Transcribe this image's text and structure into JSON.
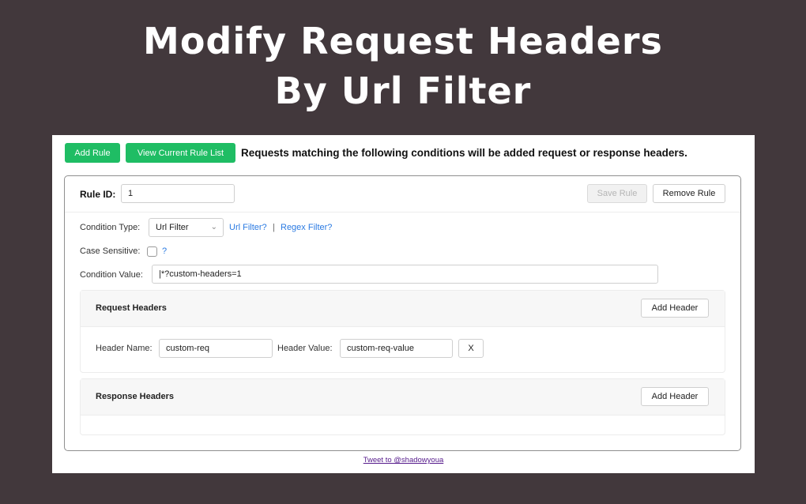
{
  "hero": {
    "line1": "Modify Request Headers",
    "line2": "By Url Filter"
  },
  "toolbar": {
    "add_rule": "Add Rule",
    "view_rules": "View Current Rule List",
    "intro": "Requests matching the following conditions will be added request or response headers."
  },
  "rule": {
    "id_label": "Rule ID:",
    "id_value": "1",
    "save_label": "Save Rule",
    "remove_label": "Remove Rule",
    "condition_type_label": "Condition Type:",
    "condition_type_value": "Url Filter",
    "url_filter_help": "Url Filter?",
    "separator": "|",
    "regex_filter_help": "Regex Filter?",
    "case_sensitive_label": "Case Sensitive:",
    "case_sensitive_help": "?",
    "condition_value_label": "Condition Value:",
    "condition_value": "|*?custom-headers=1"
  },
  "request_headers": {
    "title": "Request Headers",
    "add_label": "Add Header",
    "rows": [
      {
        "name_label": "Header Name:",
        "name_value": "custom-req",
        "value_label": "Header Value:",
        "value": "custom-req-value",
        "remove_label": "X"
      }
    ]
  },
  "response_headers": {
    "title": "Response Headers",
    "add_label": "Add Header"
  },
  "footer": {
    "tweet": "Tweet to @shadowyoua"
  },
  "colors": {
    "background": "#42383c",
    "accent_green": "#1fbd64",
    "link_blue": "#2a7ae2"
  },
  "icons": {
    "select_chevron": "chevron-down-icon"
  }
}
